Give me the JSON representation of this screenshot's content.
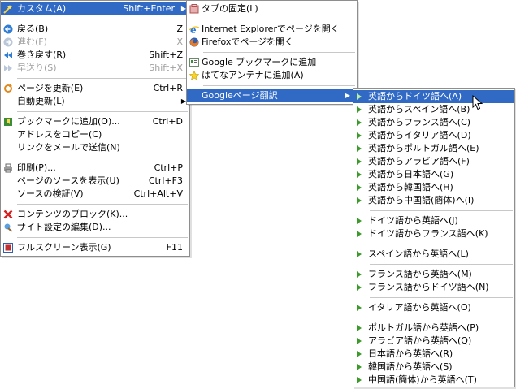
{
  "colors": {
    "highlight": "#316ac5",
    "separator": "#c8c8c8",
    "border": "#8e8e8e",
    "arrow_green": "#3c9a2a"
  },
  "menu_main": {
    "custom": {
      "label": "カスタム(A)",
      "accel": "Shift+Enter",
      "icon": "custom-wand-icon"
    },
    "back": {
      "label": "戻る(B)",
      "accel": "Z",
      "icon": "back-arrow-icon"
    },
    "forward": {
      "label": "進む(F)",
      "accel": "X",
      "icon": "forward-arrow-icon"
    },
    "rewind": {
      "label": "巻き戻す(R)",
      "accel": "Shift+Z",
      "icon": "rewind-icon"
    },
    "fastforward": {
      "label": "早送り(S)",
      "accel": "Shift+X",
      "icon": "fastforward-icon"
    },
    "reload": {
      "label": "ページを更新(E)",
      "accel": "Ctrl+R",
      "icon": "reload-icon"
    },
    "autoreload": {
      "label": "自動更新(L)"
    },
    "bookmark": {
      "label": "ブックマークに追加(O)...",
      "accel": "Ctrl+D",
      "icon": "bookmark-icon"
    },
    "copyurl": {
      "label": "アドレスをコピー(C)"
    },
    "mailink": {
      "label": "リンクをメールで送信(N)"
    },
    "print": {
      "label": "印刷(P)...",
      "accel": "Ctrl+P",
      "icon": "printer-icon"
    },
    "source": {
      "label": "ページのソースを表示(U)",
      "accel": "Ctrl+F3"
    },
    "validate": {
      "label": "ソースの検証(V)",
      "accel": "Ctrl+Alt+V"
    },
    "block": {
      "label": "コンテンツのブロック(K)...",
      "icon": "block-icon"
    },
    "siteprefs": {
      "label": "サイト設定の編集(D)...",
      "icon": "site-settings-icon"
    },
    "fullscreen": {
      "label": "フルスクリーン表示(G)",
      "accel": "F11",
      "icon": "fullscreen-icon"
    }
  },
  "menu_custom": {
    "pin_tab": {
      "label": "タブの固定(L)",
      "icon": "pin-tab-icon"
    },
    "open_ie": {
      "label": "Internet Explorerでページを開く",
      "icon": "internet-explorer-icon"
    },
    "open_firefox": {
      "label": "Firefoxでページを開く",
      "icon": "firefox-icon"
    },
    "google_bm": {
      "label": "Google ブックマークに追加",
      "icon": "google-bookmark-icon"
    },
    "hatena": {
      "label": "はてなアンテナに追加(A)",
      "icon": "star-icon"
    },
    "google_translate": {
      "label": "Googleページ翻訳"
    }
  },
  "menu_translate": [
    {
      "label": "英語からドイツ語へ(A)"
    },
    {
      "label": "英語からスペイン語へ(B)"
    },
    {
      "label": "英語からフランス語へ(C)"
    },
    {
      "label": "英語からイタリア語へ(D)"
    },
    {
      "label": "英語からポルトガル語へ(E)"
    },
    {
      "label": "英語からアラビア語へ(F)"
    },
    {
      "label": "英語から日本語へ(G)"
    },
    {
      "label": "英語から韓国語へ(H)"
    },
    {
      "label": "英語から中国語(簡体)へ(I)"
    },
    {
      "label": "ドイツ語から英語へ(J)"
    },
    {
      "label": "ドイツ語からフランス語へ(K)"
    },
    {
      "label": "スペイン語から英語へ(L)"
    },
    {
      "label": "フランス語から英語へ(M)"
    },
    {
      "label": "フランス語からドイツ語へ(N)"
    },
    {
      "label": "イタリア語から英語へ(O)"
    },
    {
      "label": "ポルトガル語から英語へ(P)"
    },
    {
      "label": "アラビア語から英語へ(Q)"
    },
    {
      "label": "日本語から英語へ(R)"
    },
    {
      "label": "韓国語から英語へ(S)"
    },
    {
      "label": "中国語(簡体)から英語へ(T)"
    }
  ]
}
